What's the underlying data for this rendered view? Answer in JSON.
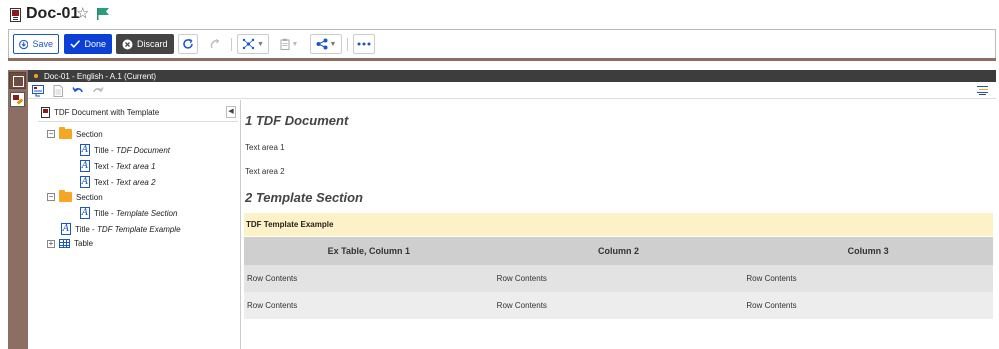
{
  "header": {
    "title": "Doc-01"
  },
  "toolbar": {
    "save_label": "Save",
    "done_label": "Done",
    "discard_label": "Discard",
    "icons": [
      "refresh-icon",
      "redo-icon",
      "network-icon",
      "clipboard-icon",
      "share-icon",
      "more-icon"
    ]
  },
  "breadcrumb": {
    "text": "Doc-01 - English - A.1 (Current)"
  },
  "tree": {
    "root": "TDF Document with Template",
    "nodes": [
      {
        "label": "Section",
        "emph": ""
      },
      {
        "label": "Title - ",
        "emph": "TDF Document"
      },
      {
        "label": "Text - ",
        "emph": "Text area 1"
      },
      {
        "label": "Text - ",
        "emph": "Text area 2"
      },
      {
        "label": "Section",
        "emph": ""
      },
      {
        "label": "Title - ",
        "emph": "Template Section"
      },
      {
        "label": "Title - ",
        "emph": "TDF Template Example"
      },
      {
        "label": "Table",
        "emph": ""
      }
    ]
  },
  "content": {
    "heading1": "1 TDF Document",
    "para1": "Text area 1",
    "para2": "Text area 2",
    "heading2": "2 Template Section",
    "template_title": "TDF Template Example",
    "table": {
      "headers": [
        "Ex Table, Column 1",
        "Column 2",
        "Column 3"
      ],
      "rows": [
        [
          "Row Contents",
          "Row Contents",
          "Row Contents"
        ],
        [
          "Row Contents",
          "Row Contents",
          "Row Contents"
        ]
      ]
    }
  },
  "colors": {
    "accent": "#0b3fd6",
    "brown": "#8d6e63",
    "folder": "#f5a623",
    "template_bg": "#fdf2c7"
  }
}
